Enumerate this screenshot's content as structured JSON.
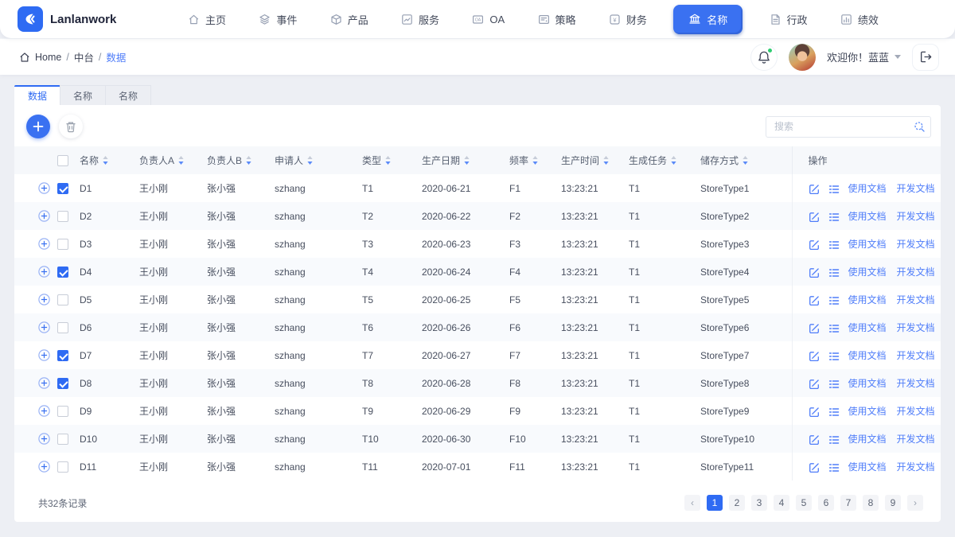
{
  "brand": {
    "name": "Lanlanwork"
  },
  "nav": {
    "items": [
      {
        "key": "home",
        "label": "主页",
        "icon": "home-icon",
        "active": false
      },
      {
        "key": "events",
        "label": "事件",
        "icon": "layers-icon",
        "active": false
      },
      {
        "key": "products",
        "label": "产品",
        "icon": "box-icon",
        "active": false
      },
      {
        "key": "services",
        "label": "服务",
        "icon": "chart-icon",
        "active": false
      },
      {
        "key": "oa",
        "label": "OA",
        "icon": "oa-icon",
        "active": false
      },
      {
        "key": "strategy",
        "label": "策略",
        "icon": "card-icon",
        "active": false
      },
      {
        "key": "finance",
        "label": "财务",
        "icon": "yen-icon",
        "active": false
      },
      {
        "key": "names",
        "label": "名称",
        "icon": "bank-icon",
        "active": true
      },
      {
        "key": "admin",
        "label": "行政",
        "icon": "document-icon",
        "active": false
      },
      {
        "key": "performance",
        "label": "绩效",
        "icon": "report-icon",
        "active": false
      }
    ]
  },
  "breadcrumb": {
    "separator": "/",
    "items": [
      {
        "key": "home",
        "label": "Home",
        "current": false
      },
      {
        "key": "middle",
        "label": "中台",
        "current": false
      },
      {
        "key": "data",
        "label": "数据",
        "current": true
      }
    ]
  },
  "user": {
    "welcome": "欢迎你！蓝蓝"
  },
  "tabs": [
    {
      "key": "data",
      "label": "数据",
      "active": true
    },
    {
      "key": "names-1",
      "label": "名称",
      "active": false
    },
    {
      "key": "names-2",
      "label": "名称",
      "active": false
    }
  ],
  "search": {
    "placeholder": "搜索"
  },
  "table": {
    "ops_header": "操作",
    "ops": {
      "use_doc": "使用文档",
      "dev_doc": "开发文档"
    },
    "columns": [
      {
        "key": "name",
        "label": "名称"
      },
      {
        "key": "ownerA",
        "label": "负责人A"
      },
      {
        "key": "ownerB",
        "label": "负责人B"
      },
      {
        "key": "applicant",
        "label": "申请人"
      },
      {
        "key": "type",
        "label": "类型"
      },
      {
        "key": "date",
        "label": "生产日期"
      },
      {
        "key": "freq",
        "label": "频率"
      },
      {
        "key": "time",
        "label": "生产时间"
      },
      {
        "key": "task",
        "label": "生成任务"
      },
      {
        "key": "store",
        "label": "储存方式"
      }
    ],
    "rows": [
      {
        "checked": true,
        "name": "D1",
        "ownerA": "王小刚",
        "ownerB": "张小强",
        "applicant": "szhang",
        "type": "T1",
        "date": "2020-06-21",
        "freq": "F1",
        "time": "13:23:21",
        "task": "T1",
        "store": "StoreType1"
      },
      {
        "checked": false,
        "name": "D2",
        "ownerA": "王小刚",
        "ownerB": "张小强",
        "applicant": "szhang",
        "type": "T2",
        "date": "2020-06-22",
        "freq": "F2",
        "time": "13:23:21",
        "task": "T1",
        "store": "StoreType2"
      },
      {
        "checked": false,
        "name": "D3",
        "ownerA": "王小刚",
        "ownerB": "张小强",
        "applicant": "szhang",
        "type": "T3",
        "date": "2020-06-23",
        "freq": "F3",
        "time": "13:23:21",
        "task": "T1",
        "store": "StoreType3"
      },
      {
        "checked": true,
        "name": "D4",
        "ownerA": "王小刚",
        "ownerB": "张小强",
        "applicant": "szhang",
        "type": "T4",
        "date": "2020-06-24",
        "freq": "F4",
        "time": "13:23:21",
        "task": "T1",
        "store": "StoreType4"
      },
      {
        "checked": false,
        "name": "D5",
        "ownerA": "王小刚",
        "ownerB": "张小强",
        "applicant": "szhang",
        "type": "T5",
        "date": "2020-06-25",
        "freq": "F5",
        "time": "13:23:21",
        "task": "T1",
        "store": "StoreType5"
      },
      {
        "checked": false,
        "name": "D6",
        "ownerA": "王小刚",
        "ownerB": "张小强",
        "applicant": "szhang",
        "type": "T6",
        "date": "2020-06-26",
        "freq": "F6",
        "time": "13:23:21",
        "task": "T1",
        "store": "StoreType6"
      },
      {
        "checked": true,
        "name": "D7",
        "ownerA": "王小刚",
        "ownerB": "张小强",
        "applicant": "szhang",
        "type": "T7",
        "date": "2020-06-27",
        "freq": "F7",
        "time": "13:23:21",
        "task": "T1",
        "store": "StoreType7"
      },
      {
        "checked": true,
        "name": "D8",
        "ownerA": "王小刚",
        "ownerB": "张小强",
        "applicant": "szhang",
        "type": "T8",
        "date": "2020-06-28",
        "freq": "F8",
        "time": "13:23:21",
        "task": "T1",
        "store": "StoreType8"
      },
      {
        "checked": false,
        "name": "D9",
        "ownerA": "王小刚",
        "ownerB": "张小强",
        "applicant": "szhang",
        "type": "T9",
        "date": "2020-06-29",
        "freq": "F9",
        "time": "13:23:21",
        "task": "T1",
        "store": "StoreType9"
      },
      {
        "checked": false,
        "name": "D10",
        "ownerA": "王小刚",
        "ownerB": "张小强",
        "applicant": "szhang",
        "type": "T10",
        "date": "2020-06-30",
        "freq": "F10",
        "time": "13:23:21",
        "task": "T1",
        "store": "StoreType10"
      },
      {
        "checked": false,
        "name": "D11",
        "ownerA": "王小刚",
        "ownerB": "张小强",
        "applicant": "szhang",
        "type": "T11",
        "date": "2020-07-01",
        "freq": "F11",
        "time": "13:23:21",
        "task": "T1",
        "store": "StoreType11"
      }
    ]
  },
  "footer": {
    "total": "共32条记录",
    "pagination": {
      "prev": "‹",
      "next": "›",
      "pages": [
        {
          "label": "1",
          "active": true
        },
        {
          "label": "2",
          "active": false
        },
        {
          "label": "3",
          "active": false
        },
        {
          "label": "4",
          "active": false
        },
        {
          "label": "5",
          "active": false
        },
        {
          "label": "6",
          "active": false
        },
        {
          "label": "7",
          "active": false
        },
        {
          "label": "8",
          "active": false
        },
        {
          "label": "9",
          "active": false
        }
      ]
    }
  },
  "colors": {
    "primary": "#3a71f1",
    "link": "#4f7df9",
    "active_tab": "#2f6bf3",
    "notification_dot": "#2ecc71",
    "row_stripe": "#f8fafd",
    "header_bg": "#f6f8fb"
  }
}
